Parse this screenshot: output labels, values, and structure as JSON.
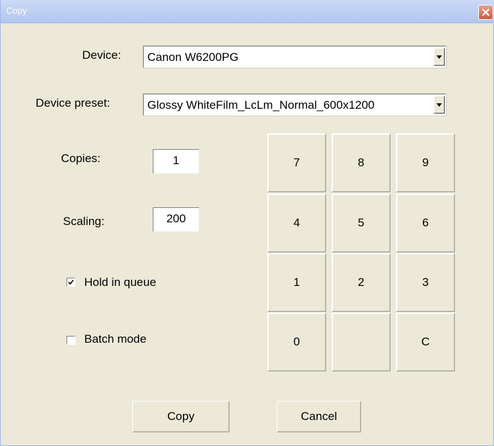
{
  "window": {
    "title": "Copy"
  },
  "device": {
    "label": "Device:",
    "value": "Canon W6200PG"
  },
  "device_preset": {
    "label": "Device preset:",
    "value": "Glossy WhiteFilm_LcLm_Normal_600x1200"
  },
  "copies": {
    "label": "Copies:",
    "value": "1"
  },
  "scaling": {
    "label": "Scaling:",
    "value": "200"
  },
  "options": {
    "hold_in_queue": {
      "label": "Hold in queue",
      "checked": true
    },
    "batch_mode": {
      "label": "Batch mode",
      "checked": false
    }
  },
  "keypad": {
    "keys": [
      "7",
      "8",
      "9",
      "4",
      "5",
      "6",
      "1",
      "2",
      "3",
      "0",
      "",
      "C"
    ]
  },
  "actions": {
    "copy_label": "Copy",
    "cancel_label": "Cancel"
  },
  "colors": {
    "dialog_background": "#ece9d8",
    "titlebar": "#bfd0f2",
    "close_button": "#c85d43"
  },
  "icons": {
    "close": "close-icon",
    "dropdown": "chevron-down-icon",
    "checkmark": "checkmark-icon"
  }
}
